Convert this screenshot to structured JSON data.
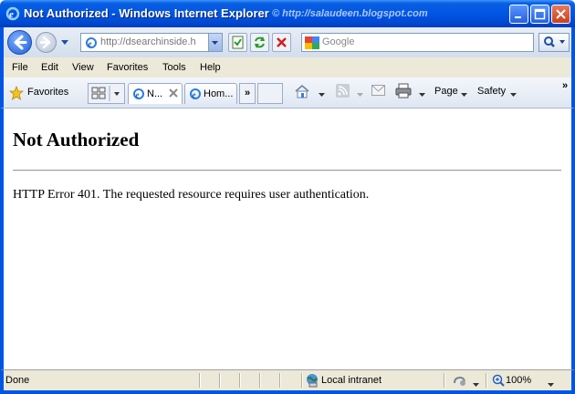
{
  "window": {
    "title": "Not Authorized - Windows Internet Explorer",
    "watermark": "© http://salaudeen.blogspot.com"
  },
  "navbar": {
    "address": "http://dsearchinside.h",
    "search_placeholder": "Google"
  },
  "menu": {
    "items": [
      "File",
      "Edit",
      "View",
      "Favorites",
      "Tools",
      "Help"
    ]
  },
  "favbar": {
    "favorites_label": "Favorites",
    "tabs": [
      {
        "label": "N..."
      },
      {
        "label": "Hom..."
      }
    ],
    "more_label": "»",
    "page_label": "Page",
    "safety_label": "Safety",
    "overflow_label": "»"
  },
  "page": {
    "heading": "Not Authorized",
    "message": "HTTP Error 401. The requested resource requires user authentication."
  },
  "status": {
    "text": "Done",
    "zone": "Local intranet",
    "zoom": "100%"
  },
  "colors": {
    "frame": "#0055e5",
    "chrome": "#ece9d8"
  }
}
